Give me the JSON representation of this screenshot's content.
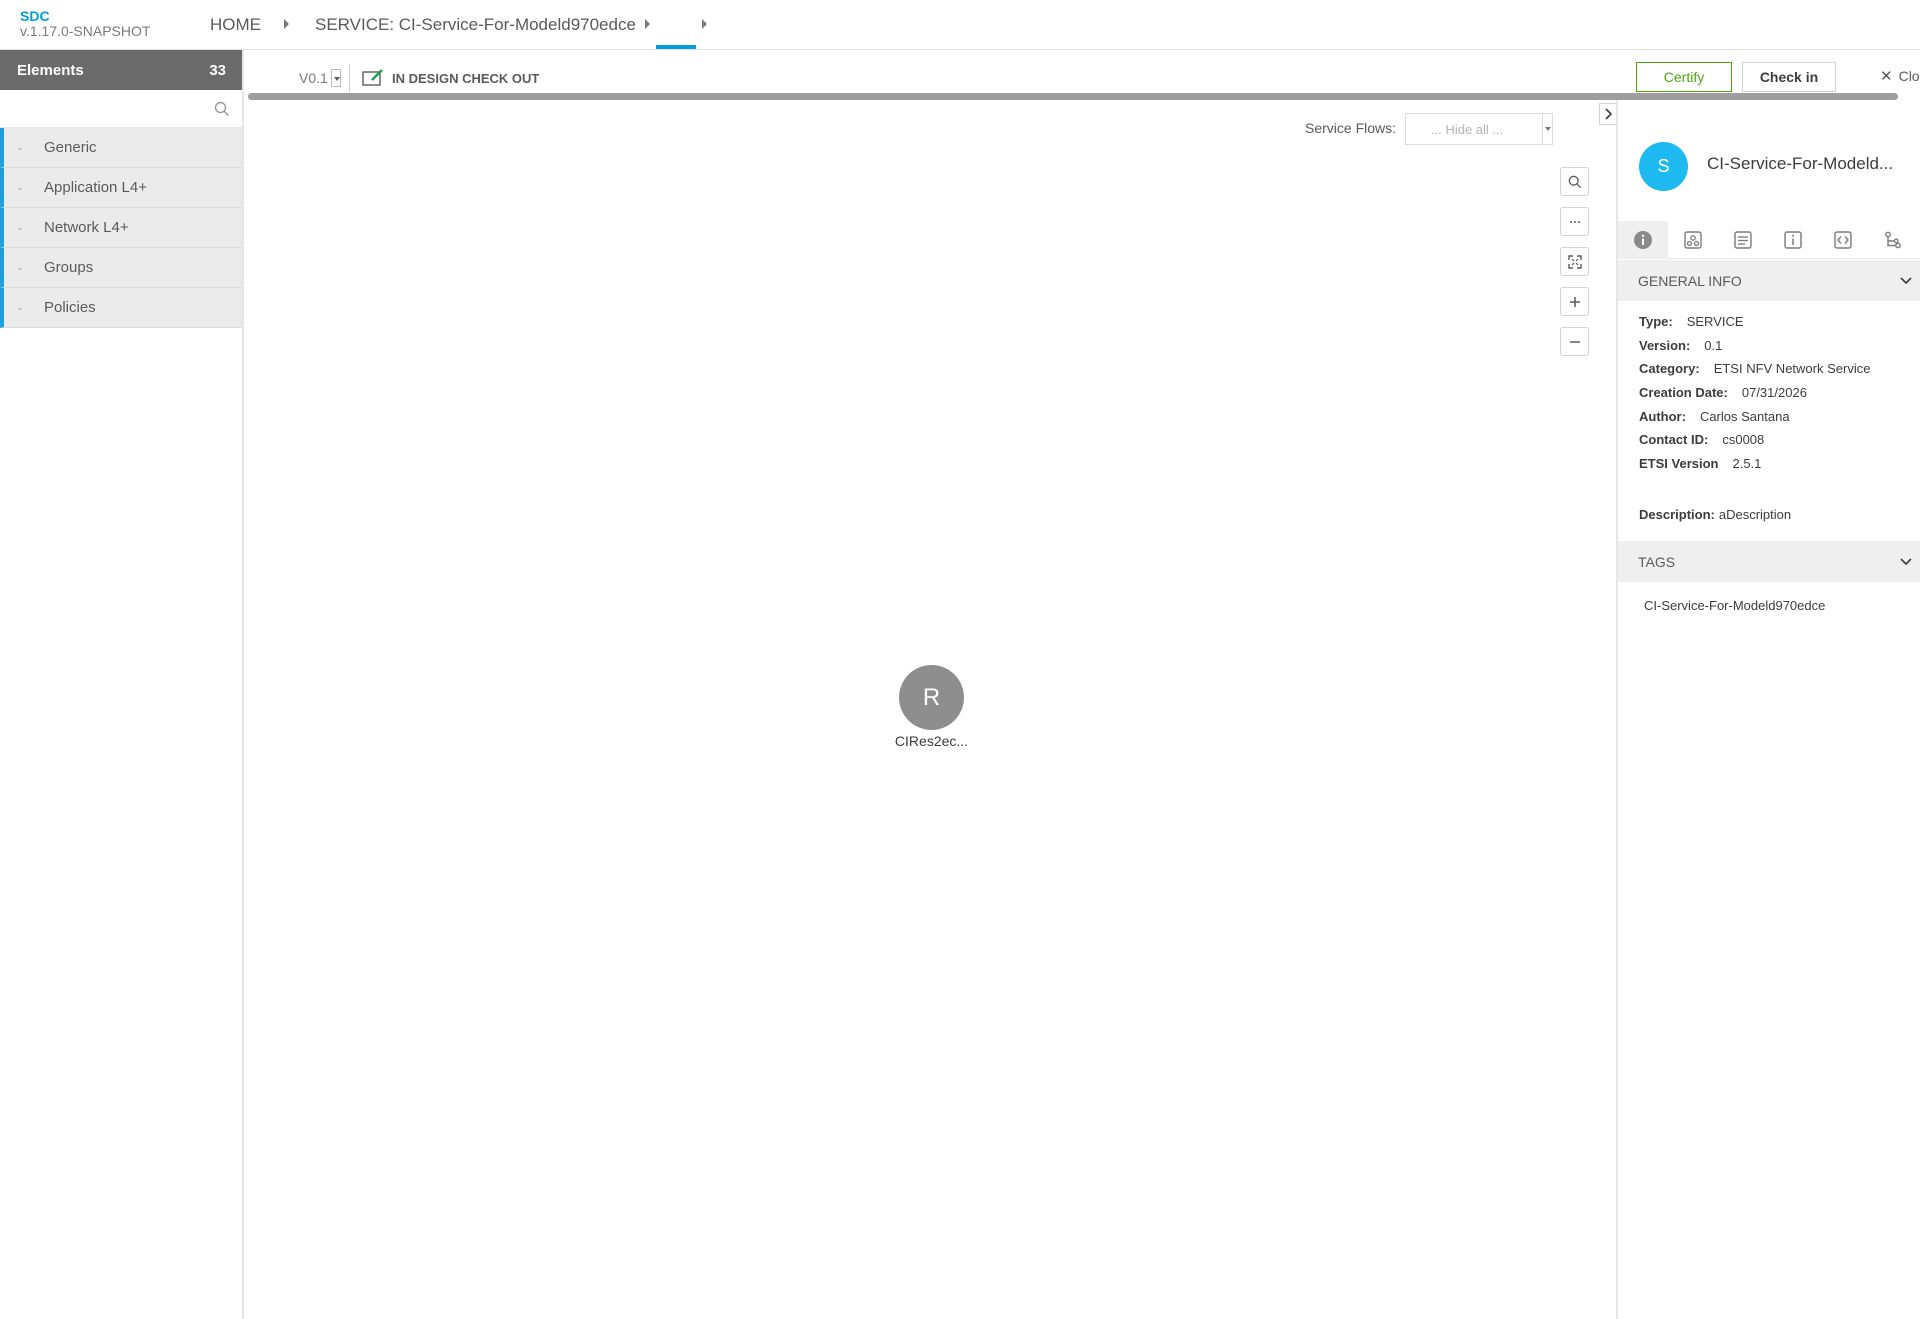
{
  "header": {
    "brand_name": "SDC",
    "brand_version": "v.1.17.0-SNAPSHOT",
    "breadcrumbs": [
      "HOME",
      "SERVICE: CI-Service-For-Modeld970edce"
    ]
  },
  "palette": {
    "title": "Elements",
    "count": "33",
    "search_placeholder": "",
    "categories": [
      {
        "dash": "-",
        "label": "Generic"
      },
      {
        "dash": "-",
        "label": "Application L4+"
      },
      {
        "dash": "-",
        "label": "Network L4+"
      },
      {
        "dash": "-",
        "label": "Groups"
      },
      {
        "dash": "-",
        "label": "Policies"
      }
    ]
  },
  "toolbar": {
    "version": "V0.1",
    "state": "IN DESIGN CHECK OUT",
    "certify_label": "Certify",
    "checkin_label": "Check in",
    "close_label": "Close"
  },
  "canvas": {
    "service_flows_label": "Service Flows:",
    "service_flows_value": "... Hide all ...",
    "node": {
      "letter": "R",
      "label": "CIRes2ec..."
    }
  },
  "details": {
    "avatar_letter": "S",
    "title": "CI-Service-For-Modeld...",
    "general_info_title": "GENERAL INFO",
    "fields": [
      {
        "key": "Type:",
        "value": "SERVICE"
      },
      {
        "key": "Version:",
        "value": "0.1"
      },
      {
        "key": "Category:",
        "value": "ETSI NFV Network Service"
      },
      {
        "key": "Creation Date:",
        "value": "07/31/2026"
      },
      {
        "key": "Author:",
        "value": "Carlos Santana"
      },
      {
        "key": "Contact ID:",
        "value": "cs0008"
      },
      {
        "key": "ETSI Version",
        "value": "2.5.1"
      }
    ],
    "description_key": "Description:",
    "description_value": "aDescription",
    "tags_title": "TAGS",
    "tags": [
      "CI-Service-For-Modeld970edce"
    ]
  },
  "colors": {
    "accent": "#009fdb",
    "palette_header": "#6b6b6b",
    "certify_green": "#4ca90c",
    "avatar_blue": "#1eb9f0",
    "node_gray": "#8e8e8e"
  },
  "icons": {
    "palette_search": "search-icon",
    "state": "edit-checkout-icon",
    "zoom_controls": [
      "search-icon",
      "more-icon",
      "fit-screen-icon",
      "zoom-in-icon",
      "zoom-out-icon"
    ],
    "detail_tabs": [
      "info-icon",
      "composition-icon",
      "deployment-artifacts-icon",
      "properties-icon",
      "api-icon",
      "relations-icon"
    ]
  }
}
